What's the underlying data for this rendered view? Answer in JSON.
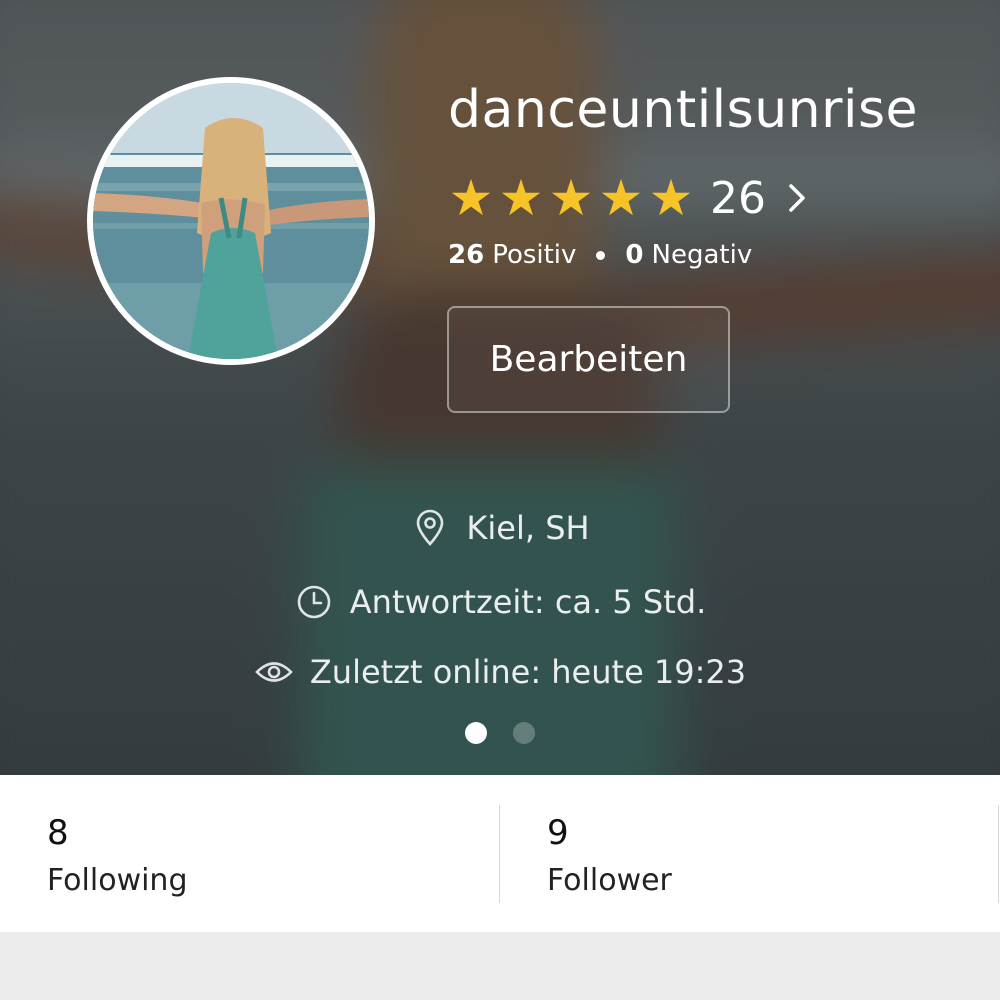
{
  "profile": {
    "username": "danceuntilsunrise",
    "rating": {
      "stars": 5,
      "star_color": "#f6c428",
      "count": "26",
      "positive_count": "26",
      "positive_label": "Positiv",
      "negative_count": "0",
      "negative_label": "Negativ"
    },
    "edit_button_label": "Bearbeiten",
    "location": "Kiel, SH",
    "response_time": "Antwortzeit: ca. 5 Std.",
    "last_online": "Zuletzt online: heute 19:23",
    "icons": {
      "location": "location-pin-icon",
      "response": "clock-icon",
      "online": "eye-icon",
      "rating_more": "chevron-right-icon"
    }
  },
  "pager": {
    "total": 2,
    "active_index": 0
  },
  "stats": {
    "following": {
      "count": "8",
      "label": "Following"
    },
    "follower": {
      "count": "9",
      "label": "Follower"
    }
  }
}
